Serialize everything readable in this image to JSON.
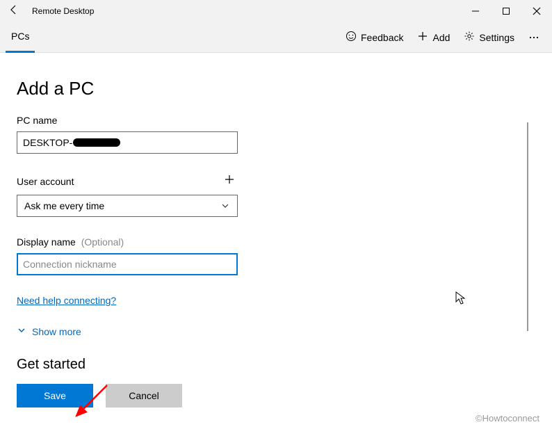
{
  "titlebar": {
    "title": "Remote Desktop"
  },
  "toolbar": {
    "tab_label": "PCs",
    "feedback_label": "Feedback",
    "add_label": "Add",
    "settings_label": "Settings"
  },
  "page": {
    "heading": "Add a PC",
    "pc_name_label": "PC name",
    "pc_name_value": "DESKTOP-",
    "user_account_label": "User account",
    "user_account_selected": "Ask me every time",
    "display_name_label": "Display name",
    "display_name_optional": "(Optional)",
    "display_name_placeholder": "Connection nickname",
    "help_link": "Need help connecting?",
    "show_more_label": "Show more",
    "get_started_heading": "Get started",
    "save_label": "Save",
    "cancel_label": "Cancel"
  },
  "watermark": "©Howtoconnect"
}
